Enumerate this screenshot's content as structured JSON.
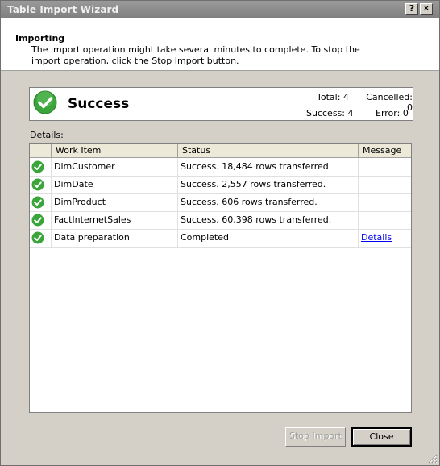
{
  "window": {
    "title": "Table Import Wizard"
  },
  "titlebar_buttons": {
    "help": "?",
    "close": "✕"
  },
  "header": {
    "title": "Importing",
    "description": "The import operation might take several minutes to complete. To stop the import operation, click the Stop Import button."
  },
  "summary": {
    "status": "Success",
    "total_label": "Total: 4",
    "cancelled_label": "Cancelled: 0",
    "success_label": "Success: 4",
    "error_label": "Error: 0",
    "status_icon": "green-check-icon"
  },
  "details": {
    "label": "Details:",
    "columns": [
      "",
      "Work Item",
      "Status",
      "Message"
    ],
    "rows": [
      {
        "work_item": "DimCustomer",
        "status": "Success. 18,484 rows transferred.",
        "message": ""
      },
      {
        "work_item": "DimDate",
        "status": "Success. 2,557 rows transferred.",
        "message": ""
      },
      {
        "work_item": "DimProduct",
        "status": "Success. 606 rows transferred.",
        "message": ""
      },
      {
        "work_item": "FactInternetSales",
        "status": "Success. 60,398 rows transferred.",
        "message": ""
      },
      {
        "work_item": "Data preparation",
        "status": "Completed",
        "message": "Details"
      }
    ]
  },
  "buttons": {
    "stop_import": "Stop Import",
    "close": "Close"
  },
  "colors": {
    "check_green": "#3aa53a",
    "titlebar": "#8c8c8c",
    "link": "#0000ee"
  }
}
